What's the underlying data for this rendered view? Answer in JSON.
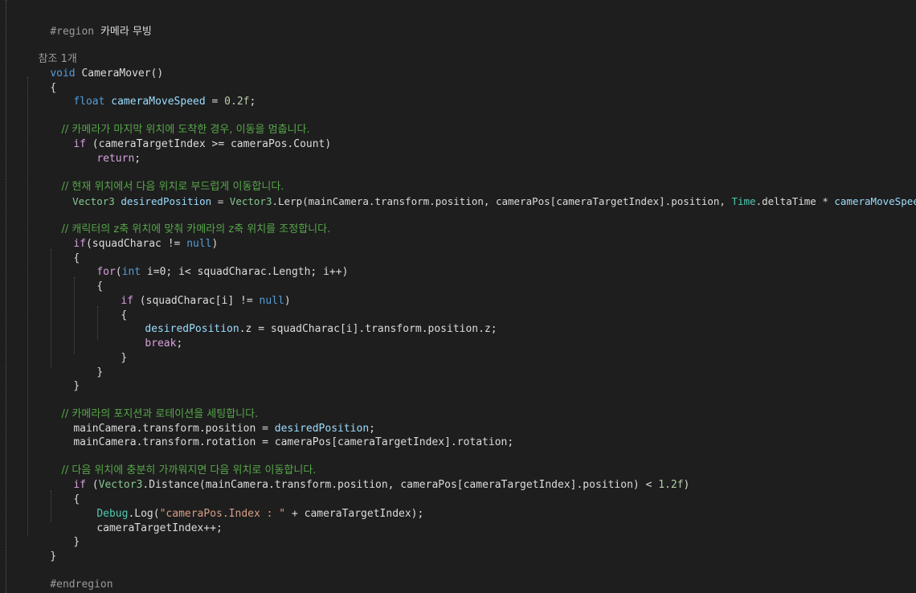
{
  "editor": {
    "region_directive": "#region",
    "region_name": "카메라 무빙",
    "references": "참조 1개",
    "endregion_directive": "#endregion",
    "code": {
      "void_kw": "void",
      "method_name": "CameraMover",
      "method_parens": "()",
      "open_brace": "{",
      "close_brace": "}",
      "float_kw": "float",
      "move_speed_var": "cameraMoveSpeed",
      "move_speed_assign": " = ",
      "move_speed_value": "0.2f",
      "semicolon": ";",
      "comment_1": "// 카메라가 마지막 위치에 도착한 경우, 이동을 멈춥니다.",
      "if_kw": "if",
      "if1_cond": " (cameraTargetIndex >= cameraPos.Count)",
      "return_kw": "return",
      "comment_2": "// 현재 위치에서 다음 위치로 부드럽게 이동합니다.",
      "vector3_type": "Vector3",
      "desired_position_var": "desiredPosition",
      "lerp_assign": " = ",
      "lerp_type": "Vector3",
      "lerp_call": ".Lerp",
      "lerp_args_1": "(mainCamera.transform.position, cameraPos[cameraTargetIndex].position, ",
      "time_class": "Time",
      "lerp_args_2": ".deltaTime * ",
      "lerp_args_3": ");",
      "comment_3": "// 캐릭터의 z축 위치에 맞춰 카메라의 z축 위치를 조정합니다.",
      "if2_open": "(squadCharac != ",
      "null_kw": "null",
      "close_paren": ")",
      "for_kw": "for",
      "for_open": "(",
      "int_kw": "int",
      "for_body": " i=0; i< squadCharac.Length; i++)",
      "if3_cond": " (squadCharac[i] != ",
      "z_assign_rhs": ".z = squadCharac[i].transform.position.z;",
      "break_kw": "break",
      "comment_4": "// 카메라의 포지션과 로테이션을 세팅합니다.",
      "set_position_lhs": "mainCamera.transform.position = ",
      "set_rotation": "mainCamera.transform.rotation = cameraPos[cameraTargetIndex].rotation;",
      "comment_5": "// 다음 위치에 충분히 가까워지면 다음 위치로 이동합니다.",
      "if4_open": " (",
      "distance_call": ".Distance",
      "distance_args": "(mainCamera.transform.position, cameraPos[cameraTargetIndex].position) < ",
      "distance_threshold": "1.2f",
      "debug_class": "Debug",
      "log_call": ".Log(",
      "log_string": "\"cameraPos.Index : \"",
      "log_rest": " + cameraTargetIndex);",
      "increment_stmt": "cameraTargetIndex++;"
    }
  }
}
